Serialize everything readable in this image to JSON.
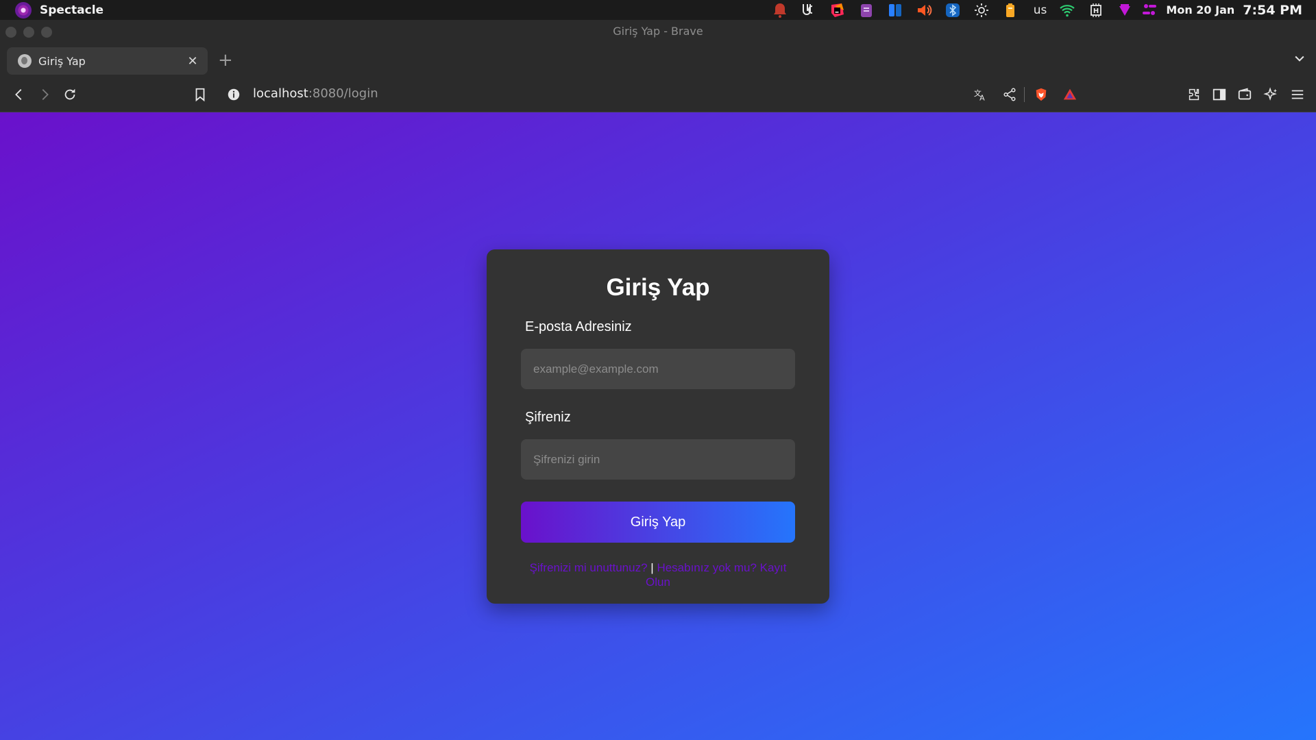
{
  "system_bar": {
    "app_name": "Spectacle",
    "keyboard_layout": "us",
    "date": "Mon 20 Jan",
    "time": "7:54 PM",
    "tray_icons": [
      "notification-bell-icon",
      "kde-connect-icon",
      "jetbrains-toolbox-icon",
      "clipboard-icon",
      "app-launcher-icon",
      "volume-icon",
      "bluetooth-icon",
      "brightness-icon",
      "battery-icon",
      "wifi-icon",
      "cpu-monitor-icon",
      "vpn-icon",
      "control-center-icon"
    ]
  },
  "window": {
    "title": "Giriş Yap - Brave"
  },
  "tabs": [
    {
      "title": "Giriş Yap",
      "favicon": "globe-icon",
      "active": true
    }
  ],
  "toolbar": {
    "url_host": "localhost",
    "url_path": ":8080/login",
    "icons_left": [
      "back-icon",
      "forward-icon",
      "reload-icon",
      "bookmark-icon",
      "site-info-icon"
    ],
    "icons_right": [
      "translate-icon",
      "share-icon",
      "brave-shields-icon",
      "brave-rewards-icon",
      "extensions-icon",
      "sidebar-icon",
      "wallet-icon",
      "leo-ai-icon",
      "menu-icon"
    ]
  },
  "login": {
    "title": "Giriş Yap",
    "email_label": "E-posta Adresiniz",
    "email_placeholder": "example@example.com",
    "password_label": "Şifreniz",
    "password_placeholder": "Şifrenizi girin",
    "submit_label": "Giriş Yap",
    "forgot_link": "Şifrenizi mi unuttunuz?",
    "separator": "|",
    "register_link": "Hesabınız yok mu? Kayıt Olun"
  },
  "colors": {
    "gradient_start": "#6a11cb",
    "gradient_end": "#2575fc",
    "card_background": "#333333",
    "input_background": "#454545",
    "link_color": "#6a11cb"
  }
}
